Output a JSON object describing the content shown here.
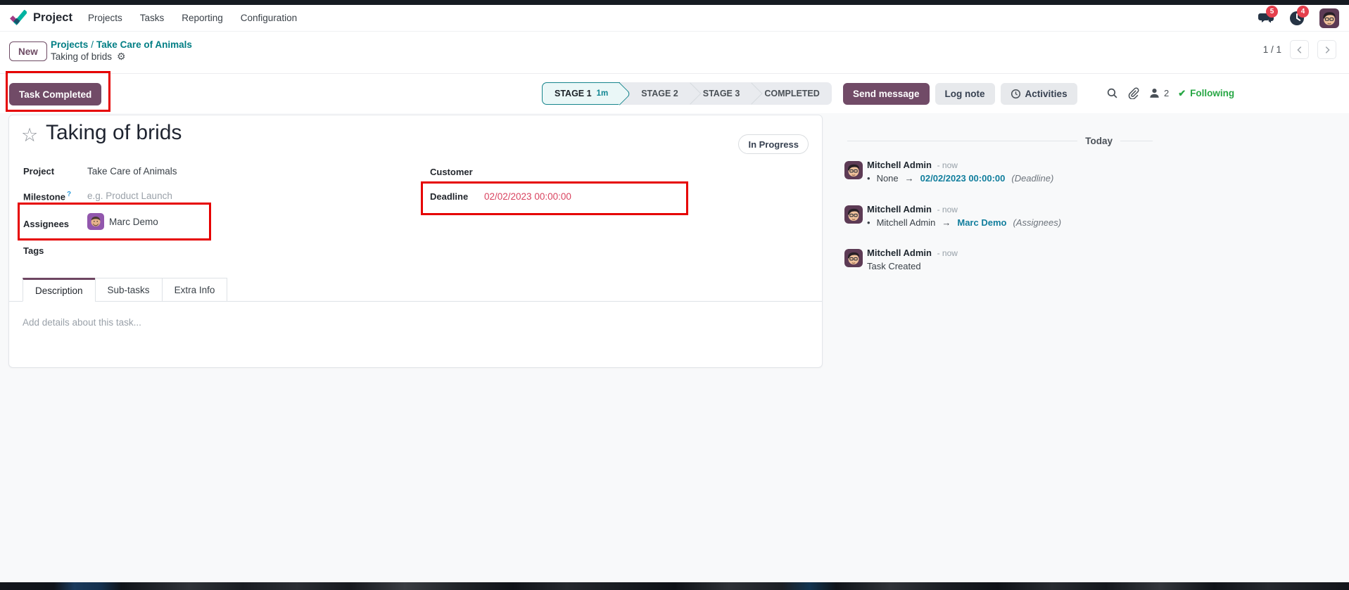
{
  "nav": {
    "brand": "Project",
    "items": [
      {
        "label": "Projects"
      },
      {
        "label": "Tasks"
      },
      {
        "label": "Reporting"
      },
      {
        "label": "Configuration"
      }
    ],
    "message_badge": "5",
    "activity_badge": "4"
  },
  "control_panel": {
    "new_button": "New",
    "breadcrumb_links": [
      "Projects",
      "Take Care of Animals"
    ],
    "breadcrumb_separator": "/",
    "breadcrumb_current": "Taking of brids",
    "pager": "1 / 1"
  },
  "statusbar": {
    "action_button": "Task Completed",
    "stages": [
      {
        "label": "STAGE 1",
        "duration": "1m"
      },
      {
        "label": "STAGE 2"
      },
      {
        "label": "STAGE 3"
      },
      {
        "label": "COMPLETED"
      }
    ]
  },
  "form": {
    "title": "Taking of brids",
    "state_badge": "In Progress",
    "fields": {
      "project_label": "Project",
      "project_value": "Take Care of Animals",
      "milestone_label": "Milestone",
      "milestone_help": "?",
      "milestone_placeholder": "e.g. Product Launch",
      "assignees_label": "Assignees",
      "assignee_name": "Marc Demo",
      "tags_label": "Tags",
      "customer_label": "Customer",
      "deadline_label": "Deadline",
      "deadline_value": "02/02/2023 00:00:00"
    },
    "tabs": [
      {
        "label": "Description"
      },
      {
        "label": "Sub-tasks"
      },
      {
        "label": "Extra Info"
      }
    ],
    "description_placeholder": "Add details about this task..."
  },
  "chatter": {
    "send_message": "Send message",
    "log_note": "Log note",
    "activities": "Activities",
    "followers_count": "2",
    "following_label": "Following",
    "date_divider": "Today",
    "messages": [
      {
        "author": "Mitchell Admin",
        "time": "- now",
        "old": "None",
        "arrow": "→",
        "new": "02/02/2023 00:00:00",
        "field": "(Deadline)"
      },
      {
        "author": "Mitchell Admin",
        "time": "- now",
        "old": "Mitchell Admin",
        "arrow": "→",
        "new": "Marc Demo",
        "field": "(Assignees)"
      },
      {
        "author": "Mitchell Admin",
        "time": "- now",
        "body": "Task Created"
      }
    ]
  },
  "colors": {
    "primary": "#714B67",
    "link_teal": "#017e84",
    "annotation_red": "#e60000",
    "deadline_red": "#d9435f",
    "following_green": "#28a745",
    "tracking_new": "#117e9d",
    "badge_red": "#e5404e"
  }
}
